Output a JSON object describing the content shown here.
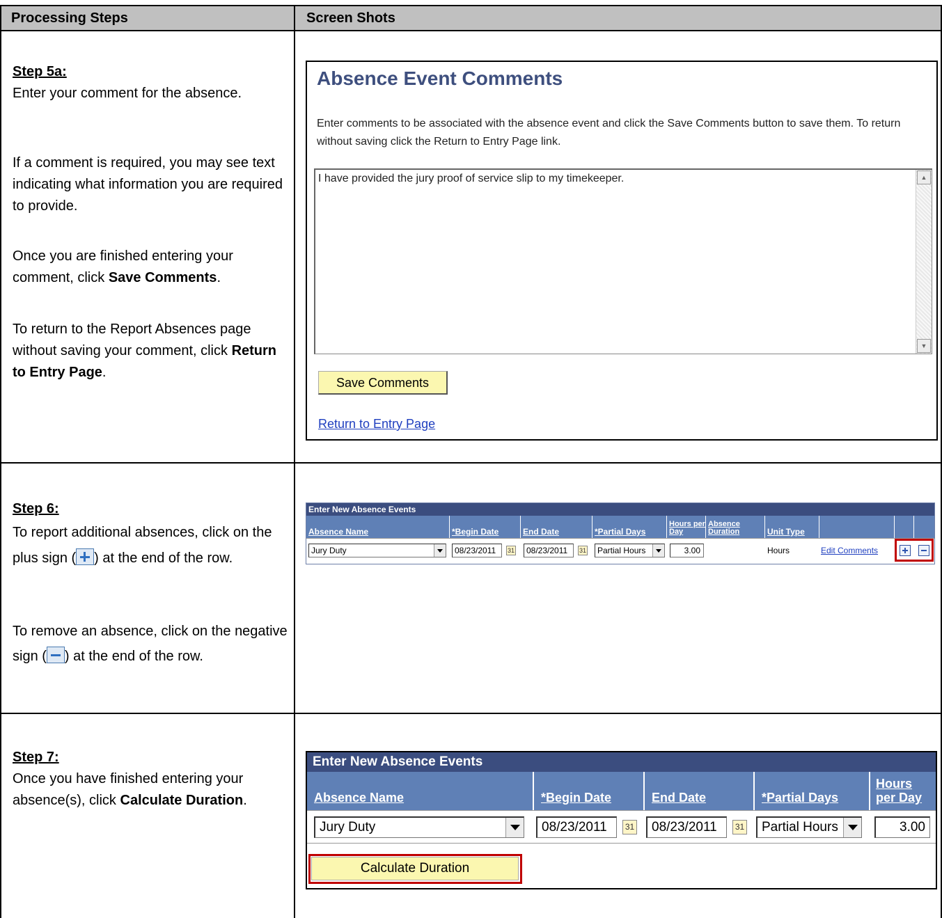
{
  "headers": {
    "left": "Processing Steps",
    "right": "Screen Shots"
  },
  "step5a": {
    "title": "Step 5a:",
    "p1": "Enter your comment for the absence.",
    "p2": "If a comment is required, you may see text indicating what information you are required to provide.",
    "p3_pre": "Once you are finished entering your comment, click ",
    "p3_bold": "Save Comments",
    "p3_post": ".",
    "p4_pre": "To return to the Report Absences page without saving your comment, click ",
    "p4_bold": "Return to Entry Page",
    "p4_post": "."
  },
  "comments_screen": {
    "title": "Absence Event Comments",
    "description": "Enter comments to be associated with the absence event and click the Save Comments button to save them. To return without saving click the Return to Entry Page link.",
    "comment_text": "I have provided the jury proof of service slip to my timekeeper.",
    "save_label": "Save Comments",
    "return_link": "Return to Entry Page"
  },
  "step6": {
    "title": "Step 6:",
    "p1_pre": "To report additional absences, click on the plus sign (",
    "p1_post": ") at the end of the row.",
    "p2_pre": "To remove an absence, click on the negative sign (",
    "p2_post": ") at the end of the row."
  },
  "grid": {
    "bar_title": "Enter New Absence Events",
    "headers": {
      "absence_name": "Absence Name",
      "begin_date": "*Begin Date",
      "end_date": "End Date",
      "partial_days": "*Partial Days",
      "hours_per_day": "Hours per Day",
      "absence_duration": "Absence Duration",
      "unit_type": "Unit Type"
    },
    "row": {
      "absence_name": "Jury Duty",
      "begin_date": "08/23/2011",
      "end_date": "08/23/2011",
      "partial_days": "Partial Hours",
      "hours_per_day": "3.00",
      "unit_type": "Hours",
      "edit_comments": "Edit Comments"
    }
  },
  "step7": {
    "title": "Step 7:",
    "p1_pre": "Once you have finished entering your absence(s), click ",
    "p1_bold": "Calculate Duration",
    "p1_post": ".",
    "calc_label": "Calculate Duration"
  },
  "colors": {
    "header_bg": "#c0c0c0",
    "grid_bar": "#3b4d7f",
    "grid_header": "#5f80b6",
    "button_yellow": "#fbf7b0",
    "highlight_red": "#c00000",
    "title_blue": "#3e4f7e"
  }
}
